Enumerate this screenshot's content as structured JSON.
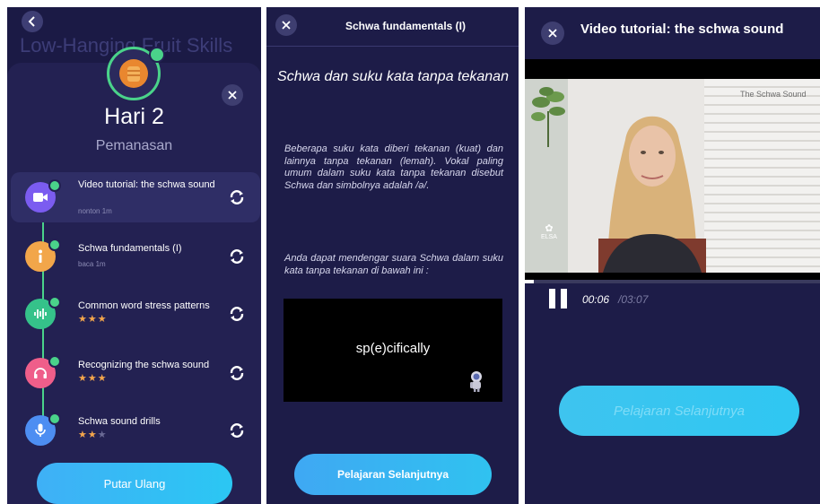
{
  "panel1": {
    "background_title": "Low-Hanging Fruit Skills",
    "day_title": "Hari 2",
    "day_subtitle": "Pemanasan",
    "lessons": [
      {
        "title": "Video tutorial: the schwa sound",
        "meta": "nonton 1m",
        "stars": null,
        "icon": "video-camera-icon",
        "color": "#7b5cf0"
      },
      {
        "title": "Schwa fundamentals (I)",
        "meta": "baca 1m",
        "stars": null,
        "icon": "info-icon",
        "color": "#f2a64a"
      },
      {
        "title": "Common word stress patterns",
        "meta": null,
        "stars": 3,
        "icon": "soundwave-icon",
        "color": "#35c28a"
      },
      {
        "title": "Recognizing the schwa sound",
        "meta": null,
        "stars": 3,
        "icon": "headphones-icon",
        "color": "#ef5e8a"
      },
      {
        "title": "Schwa sound drills",
        "meta": null,
        "stars": 2,
        "icon": "microphone-icon",
        "color": "#4d8ef2"
      }
    ],
    "replay_button": "Putar Ulang"
  },
  "panel2": {
    "header_title": "Schwa fundamentals (I)",
    "heading": "Schwa dan suku kata tanpa tekanan",
    "paragraph1": "Beberapa suku kata diberi tekanan (kuat) dan lainnya tanpa tekanan (lemah). Vokal paling umum dalam suku kata tanpa tekanan disebut Schwa dan simbolnya adalah /ə/.",
    "paragraph2": "Anda dapat mendengar suara Schwa dalam suku kata tanpa tekanan di bawah ini :",
    "video_word": "sp(e)cifically",
    "next_button": "Pelajaran Selanjutnya"
  },
  "panel3": {
    "title": "Video tutorial: the schwa sound",
    "video_watermark": "The Schwa Sound",
    "video_logo": "ELSA",
    "time_current": "00:06",
    "time_total": "/03:07",
    "progress_fraction": 0.03,
    "next_button": "Pelajaran Selanjutnya"
  },
  "colors": {
    "accent_green": "#4ad38a",
    "star": "#f3a64c",
    "button_blue": "#2fc7f2",
    "background": "#1c1b47"
  }
}
